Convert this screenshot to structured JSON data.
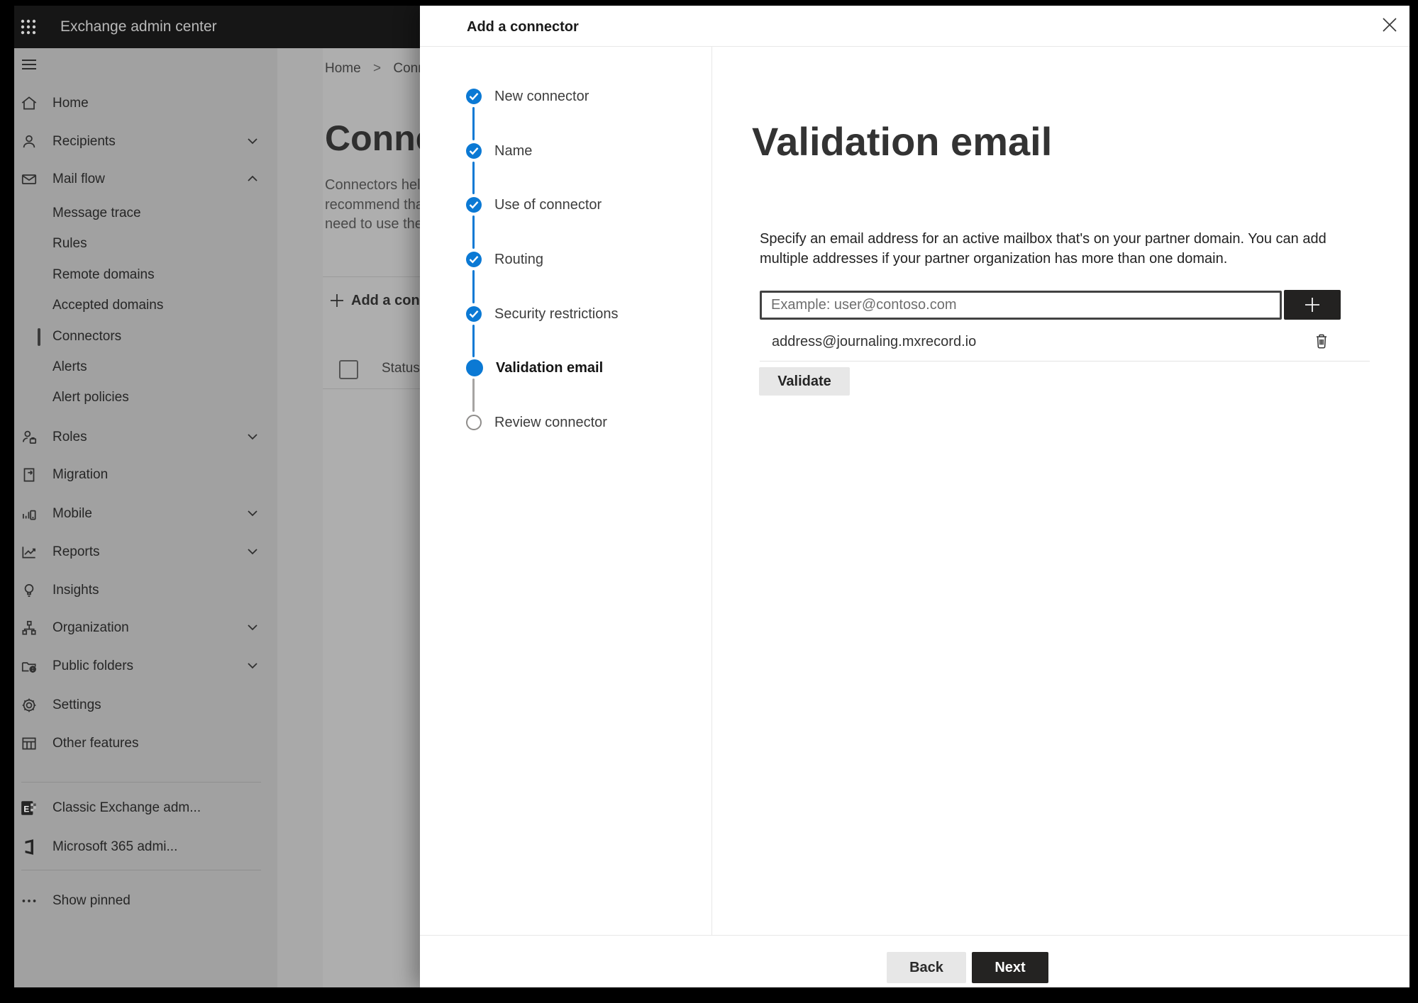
{
  "header": {
    "app_title": "Exchange admin center"
  },
  "sidebar": {
    "items": [
      {
        "label": "Home",
        "icon": "home-icon"
      },
      {
        "label": "Recipients",
        "icon": "person-icon",
        "chevron": "down"
      },
      {
        "label": "Mail flow",
        "icon": "mail-icon",
        "chevron": "up",
        "expanded": true
      },
      {
        "label": "Message trace",
        "indent": true
      },
      {
        "label": "Rules",
        "indent": true
      },
      {
        "label": "Remote domains",
        "indent": true
      },
      {
        "label": "Accepted domains",
        "indent": true
      },
      {
        "label": "Connectors",
        "indent": true,
        "selected": true
      },
      {
        "label": "Alerts",
        "indent": true
      },
      {
        "label": "Alert policies",
        "indent": true
      },
      {
        "label": "Roles",
        "icon": "roles-icon",
        "chevron": "down"
      },
      {
        "label": "Migration",
        "icon": "migration-icon"
      },
      {
        "label": "Mobile",
        "icon": "mobile-icon",
        "chevron": "down"
      },
      {
        "label": "Reports",
        "icon": "reports-icon",
        "chevron": "down"
      },
      {
        "label": "Insights",
        "icon": "insights-icon"
      },
      {
        "label": "Organization",
        "icon": "organization-icon",
        "chevron": "down"
      },
      {
        "label": "Public folders",
        "icon": "public-folders-icon",
        "chevron": "down"
      },
      {
        "label": "Settings",
        "icon": "settings-icon"
      },
      {
        "label": "Other features",
        "icon": "other-features-icon"
      }
    ],
    "footer_items": [
      {
        "label": "Classic Exchange adm...",
        "icon": "classic-exchange-icon"
      },
      {
        "label": "Microsoft 365 admi...",
        "icon": "microsoft-365-icon"
      },
      {
        "label": "Show pinned",
        "icon": "ellipsis-icon"
      }
    ]
  },
  "background_page": {
    "breadcrumb": {
      "home": "Home",
      "separator": ">",
      "current": "Conne"
    },
    "page_title": "Connec",
    "intro_lines": [
      "Connectors help",
      "recommend tha",
      "need to use ther"
    ],
    "add_connector_button": "Add a conn",
    "table": {
      "status_header": "Status"
    }
  },
  "dialog": {
    "title": "Add a connector",
    "steps": [
      {
        "label": "New connector",
        "state": "completed"
      },
      {
        "label": "Name",
        "state": "completed"
      },
      {
        "label": "Use of connector",
        "state": "completed"
      },
      {
        "label": "Routing",
        "state": "completed"
      },
      {
        "label": "Security restrictions",
        "state": "completed"
      },
      {
        "label": "Validation email",
        "state": "current"
      },
      {
        "label": "Review connector",
        "state": "upcoming"
      }
    ],
    "content": {
      "heading": "Validation email",
      "description_lines": [
        "Specify an email address for an active mailbox that's on your partner domain. You can add",
        "multiple addresses if your partner organization has more than one domain."
      ],
      "email_input": {
        "value": "",
        "placeholder": "Example: user@contoso.com"
      },
      "added_emails": [
        {
          "address": "address@journaling.mxrecord.io"
        }
      ],
      "validate_button": "Validate"
    },
    "footer": {
      "back_button": "Back",
      "next_button": "Next"
    }
  },
  "colors": {
    "accent_blue": "#0b79d4",
    "dark_button": "#242322",
    "neutral_button": "#e7e7e7",
    "header_bar": "#161616",
    "dimmed_nav": "#a1a1a1",
    "dimmed_page": "#a9a9a9"
  }
}
